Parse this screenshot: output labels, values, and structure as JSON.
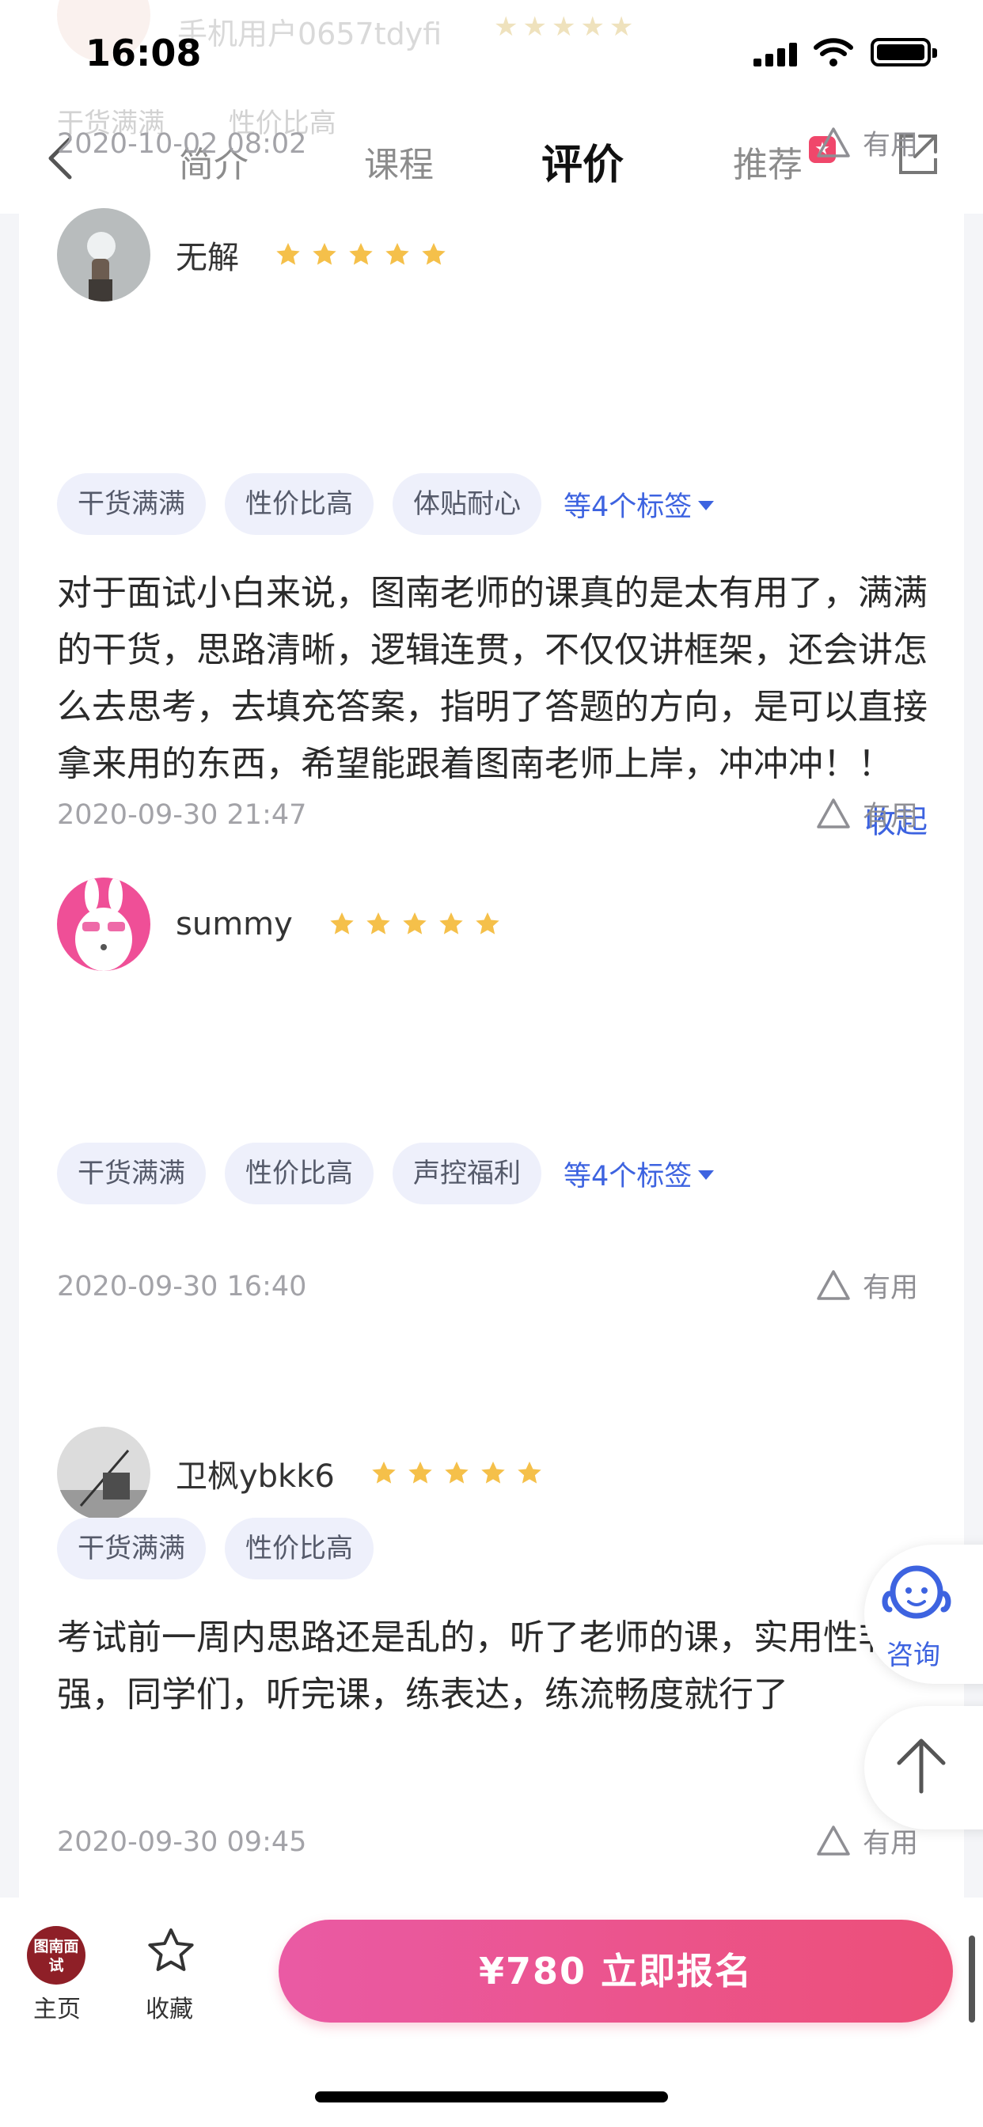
{
  "status_bar": {
    "time": "16:08"
  },
  "ghost": {
    "name": "手机用户0657tdyfi",
    "tags": [
      "干货满满",
      "性价比高"
    ]
  },
  "nav": {
    "tabs": [
      "简介",
      "课程",
      "评价",
      "推荐"
    ],
    "active_tab": "评价",
    "hot_badge": "★"
  },
  "reviews": [
    {
      "date": "2020-10-02 08:02",
      "useful": "有用"
    },
    {
      "user": "无解",
      "rating": 5,
      "tags": [
        "干货满满",
        "性价比高",
        "体贴耐心"
      ],
      "more_tags": "等4个标签",
      "text": "对于面试小白来说，图南老师的课真的是太有用了，满满的干货，思路清晰，逻辑连贯，不仅仅讲框架，还会讲怎么去思考，去填充答案，指明了答题的方向，是可以直接拿来用的东西，希望能跟着图南老师上岸，冲冲冲！！",
      "collapse": "收起",
      "date": "2020-09-30 21:47",
      "useful": "有用"
    },
    {
      "user": "summy",
      "rating": 5,
      "tags": [
        "干货满满",
        "性价比高",
        "声控福利"
      ],
      "more_tags": "等4个标签",
      "date": "2020-09-30 16:40",
      "useful": "有用"
    },
    {
      "user": "卫枫ybkk6",
      "rating": 5,
      "tags": [
        "干货满满",
        "性价比高"
      ],
      "text": "考试前一周内思路还是乱的，听了老师的课，实用性非常强，同学们，听完课，练表达，练流畅度就行了",
      "date": "2020-09-30 09:45",
      "useful": "有用"
    }
  ],
  "floating": {
    "consult": "咨询"
  },
  "bottom_bar": {
    "logo_text": "图南面试",
    "home": "主页",
    "favorite": "收藏",
    "cta": "¥780 立即报名"
  },
  "colors": {
    "accent": "#3d63e0",
    "star": "#f5c04a",
    "cta_start": "#ea5aa4",
    "cta_end": "#ec4f78"
  }
}
